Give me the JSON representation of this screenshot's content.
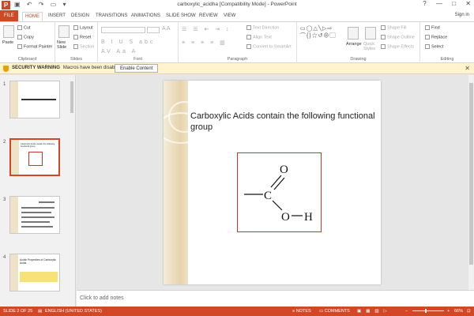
{
  "window": {
    "title": "carboxylic_acidha [Compatibility Mode] - PowerPoint",
    "controls": [
      "?",
      "—",
      "□",
      "✕"
    ]
  },
  "tabs": [
    "FILE",
    "HOME",
    "INSERT",
    "DESIGN",
    "TRANSITIONS",
    "ANIMATIONS",
    "SLIDE SHOW",
    "REVIEW",
    "VIEW"
  ],
  "signin": "Sign in",
  "ribbon": {
    "clipboard": {
      "name": "Clipboard",
      "paste": "Paste",
      "cut": "Cut",
      "copy": "Copy",
      "format_painter": "Format Painter"
    },
    "slides": {
      "name": "Slides",
      "new_slide": "New Slide",
      "layout": "Layout",
      "reset": "Reset",
      "section": "Section"
    },
    "font": {
      "name": "Font"
    },
    "paragraph": {
      "name": "Paragraph",
      "text_direction": "Text Direction",
      "align_text": "Align Text",
      "convert": "Convert to SmartArt"
    },
    "drawing": {
      "name": "Drawing",
      "arrange": "Arrange",
      "quick_styles": "Quick Styles",
      "shape_fill": "Shape Fill",
      "shape_outline": "Shape Outline",
      "shape_effects": "Shape Effects"
    },
    "editing": {
      "name": "Editing",
      "find": "Find",
      "replace": "Replace",
      "select": "Select"
    }
  },
  "security": {
    "label": "SECURITY WARNING",
    "message": "Macros have been disabled.",
    "button": "Enable Content"
  },
  "thumbnails": [
    {
      "num": "1"
    },
    {
      "num": "2"
    },
    {
      "num": "3"
    },
    {
      "num": "4",
      "title": "Acidic Properties of Carboxylic Acids"
    }
  ],
  "thumb2": {
    "title": "Carboxylic Acids contain the following functional group"
  },
  "slide": {
    "title": "Carboxylic Acids contain the following functional group",
    "formula": {
      "o_top": "O",
      "c": "C",
      "o_bottom": "O",
      "h": "H"
    }
  },
  "notes": {
    "placeholder": "Click to add notes"
  },
  "status": {
    "slide": "SLIDE 2 OF 25",
    "language": "ENGLISH (UNITED STATES)",
    "notes": "NOTES",
    "comments": "COMMENTS",
    "zoom": "66%"
  },
  "colors": {
    "accent": "#d24726",
    "security_bar": "#fff4ce",
    "formula_border": "#c0392b"
  }
}
